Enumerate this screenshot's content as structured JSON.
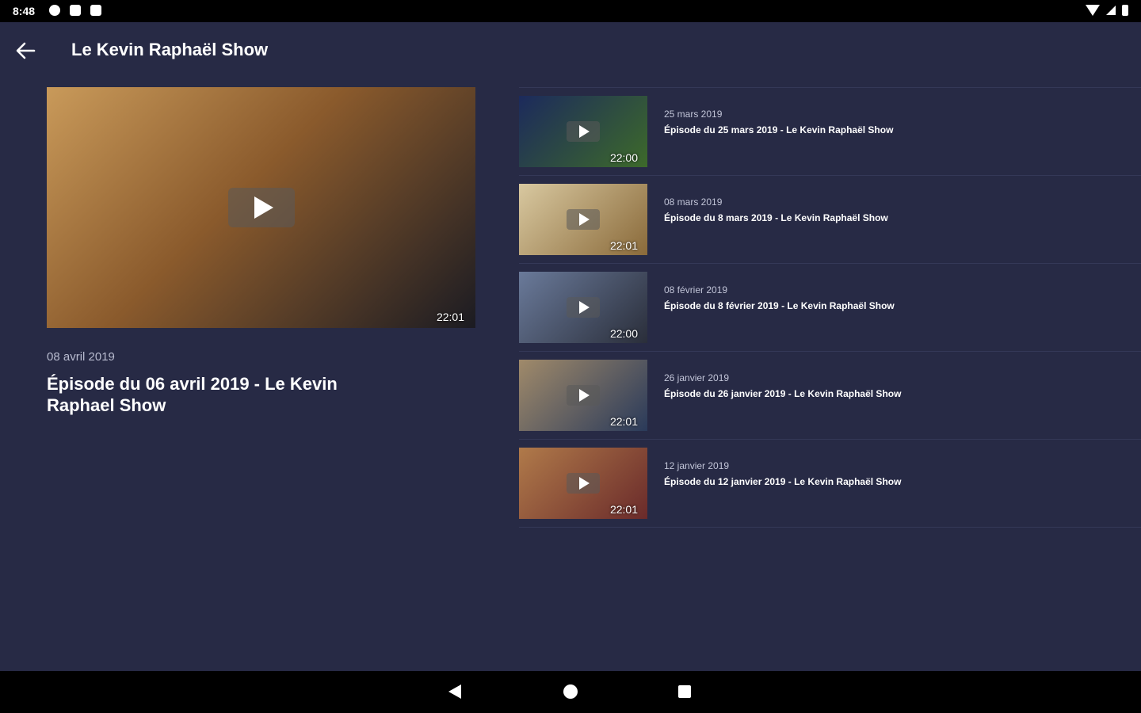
{
  "status": {
    "time": "8:48"
  },
  "header": {
    "title": "Le Kevin Raphaël Show"
  },
  "featured": {
    "date": "08 avril 2019",
    "title": "Épisode du 06 avril 2019 - Le Kevin Raphael Show",
    "duration": "22:01",
    "thumb_colors": [
      "#8a5a2c",
      "#c99a5a",
      "#1b1b22"
    ]
  },
  "episodes": [
    {
      "date": "25 mars 2019",
      "title": "Épisode du 25 mars 2019 - Le Kevin Raphaël Show",
      "duration": "22:00",
      "thumb_colors": [
        "#3d6a2a",
        "#1c2a5c"
      ]
    },
    {
      "date": "08 mars 2019",
      "title": "Épisode du 8 mars 2019 - Le Kevin Raphaël Show",
      "duration": "22:01",
      "thumb_colors": [
        "#8a6a3a",
        "#d8c8a0"
      ]
    },
    {
      "date": "08 février 2019",
      "title": "Épisode du 8 février 2019 - Le Kevin Raphaël Show",
      "duration": "22:00",
      "thumb_colors": [
        "#2a2e3a",
        "#6a7a9a"
      ]
    },
    {
      "date": "26 janvier 2019",
      "title": "Épisode du 26 janvier 2019 - Le Kevin Raphaël Show",
      "duration": "22:01",
      "thumb_colors": [
        "#2a3a5a",
        "#a08a6a"
      ]
    },
    {
      "date": "12 janvier 2019",
      "title": "Épisode du 12 janvier 2019 - Le Kevin Raphaël Show",
      "duration": "22:01",
      "thumb_colors": [
        "#6a2a2a",
        "#b07a4a"
      ]
    }
  ],
  "colors": {
    "background": "#272a45",
    "divider": "#343857"
  }
}
